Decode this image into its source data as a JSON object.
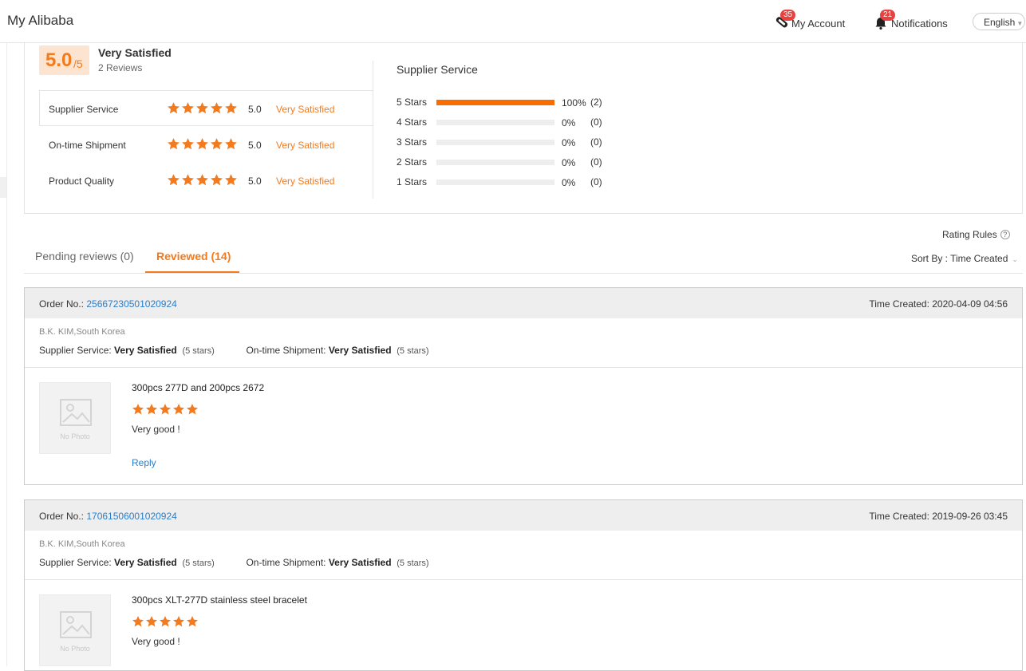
{
  "header": {
    "brand": "My Alibaba",
    "account_badge": "35",
    "account_label": "My Account",
    "notifications_badge": "21",
    "notifications_label": "Notifications",
    "language": "English"
  },
  "summary": {
    "score": "5.0",
    "score_of": "/5",
    "overall_label": "Very Satisfied",
    "reviews_count": "2 Reviews",
    "ratings": [
      {
        "label": "Supplier Service",
        "stars": 5,
        "value": "5.0",
        "satisfaction": "Very Satisfied"
      },
      {
        "label": "On-time Shipment",
        "stars": 5,
        "value": "5.0",
        "satisfaction": "Very Satisfied"
      },
      {
        "label": "Product Quality",
        "stars": 5,
        "value": "5.0",
        "satisfaction": "Very Satisfied"
      }
    ],
    "distribution_title": "Supplier Service",
    "distribution": [
      {
        "label": "5  Stars",
        "fraction": 1.0,
        "percent": "100%",
        "count": "(2)"
      },
      {
        "label": "4  Stars",
        "fraction": 0.0,
        "percent": "0%",
        "count": "(0)"
      },
      {
        "label": "3  Stars",
        "fraction": 0.0,
        "percent": "0%",
        "count": "(0)"
      },
      {
        "label": "2  Stars",
        "fraction": 0.0,
        "percent": "0%",
        "count": "(0)"
      },
      {
        "label": "1  Stars",
        "fraction": 0.0,
        "percent": "0%",
        "count": "(0)"
      }
    ]
  },
  "toolbar": {
    "rating_rules": "Rating Rules",
    "tabs": [
      "Pending reviews (0)",
      "Reviewed (14)"
    ],
    "sort_label": "Sort By : Time Created"
  },
  "reviews": [
    {
      "order_label": "Order No.: ",
      "order_no": "25667230501020924",
      "time_created": "Time Created: 2020-04-09 04:56",
      "buyer": "B.K. KIM,South Korea",
      "supplier_service_label": "Supplier Service: ",
      "supplier_service_value": "Very Satisfied",
      "supplier_service_stars": "(5 stars)",
      "shipment_label": "On-time Shipment: ",
      "shipment_value": "Very Satisfied",
      "shipment_stars": "(5 stars)",
      "no_photo": "No Photo",
      "product": "300pcs 277D and 200pcs 2672",
      "stars": 5,
      "comment": "Very good !",
      "reply": "Reply"
    },
    {
      "order_label": "Order No.: ",
      "order_no": "17061506001020924",
      "time_created": "Time Created: 2019-09-26 03:45",
      "buyer": "B.K. KIM,South Korea",
      "supplier_service_label": "Supplier Service: ",
      "supplier_service_value": "Very Satisfied",
      "supplier_service_stars": "(5 stars)",
      "shipment_label": "On-time Shipment: ",
      "shipment_value": "Very Satisfied",
      "shipment_stars": "(5 stars)",
      "no_photo": "No Photo",
      "product": "300pcs XLT-277D stainless steel bracelet",
      "stars": 5,
      "comment": "Very good !"
    }
  ],
  "colors": {
    "accent": "#f27a1f",
    "bar_fill": "#f96d00",
    "link": "#2a7dc9",
    "badge": "#e64340"
  }
}
